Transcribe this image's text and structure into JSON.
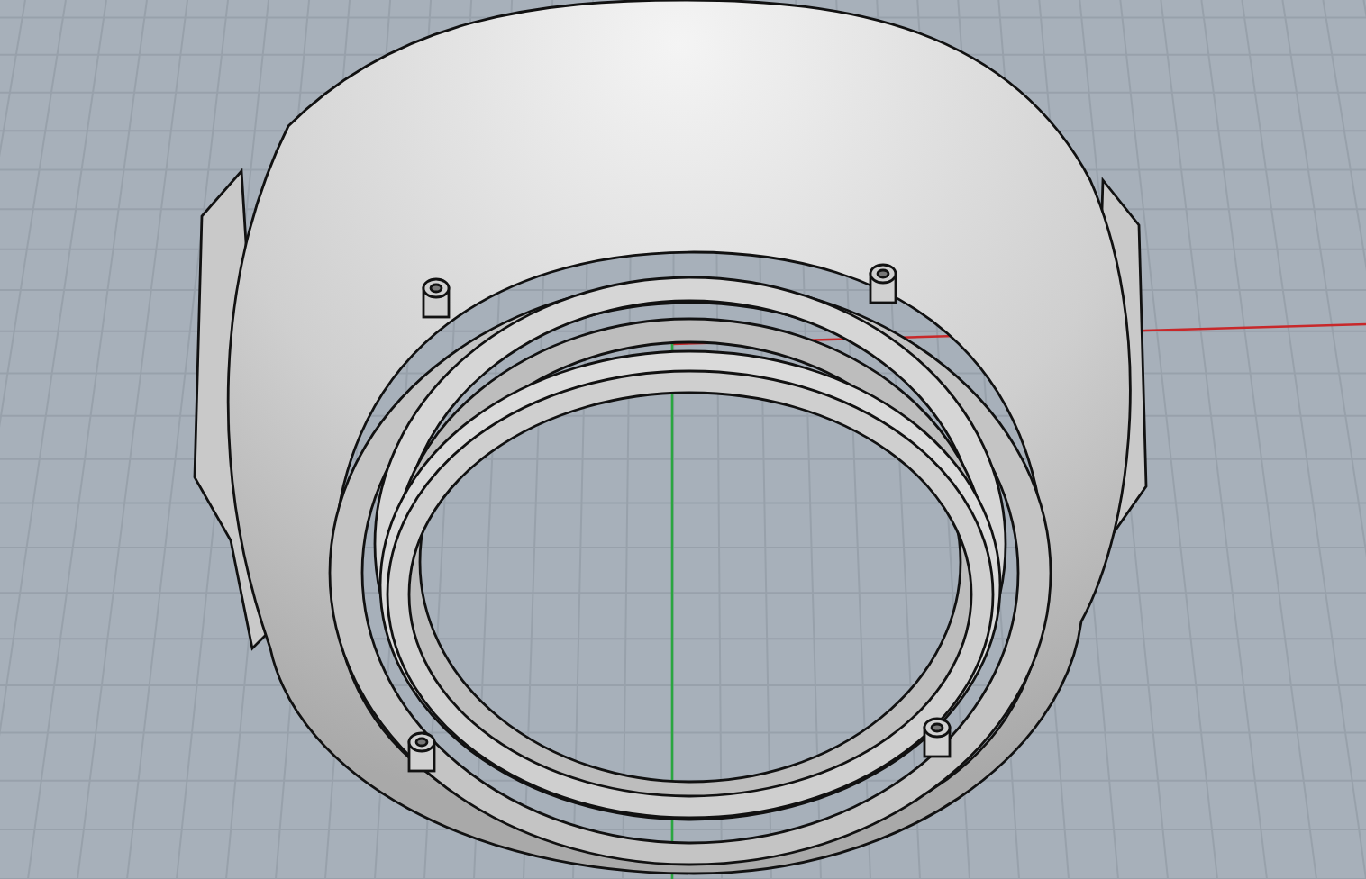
{
  "viewport": {
    "grid": true,
    "axes": true,
    "model": true
  }
}
